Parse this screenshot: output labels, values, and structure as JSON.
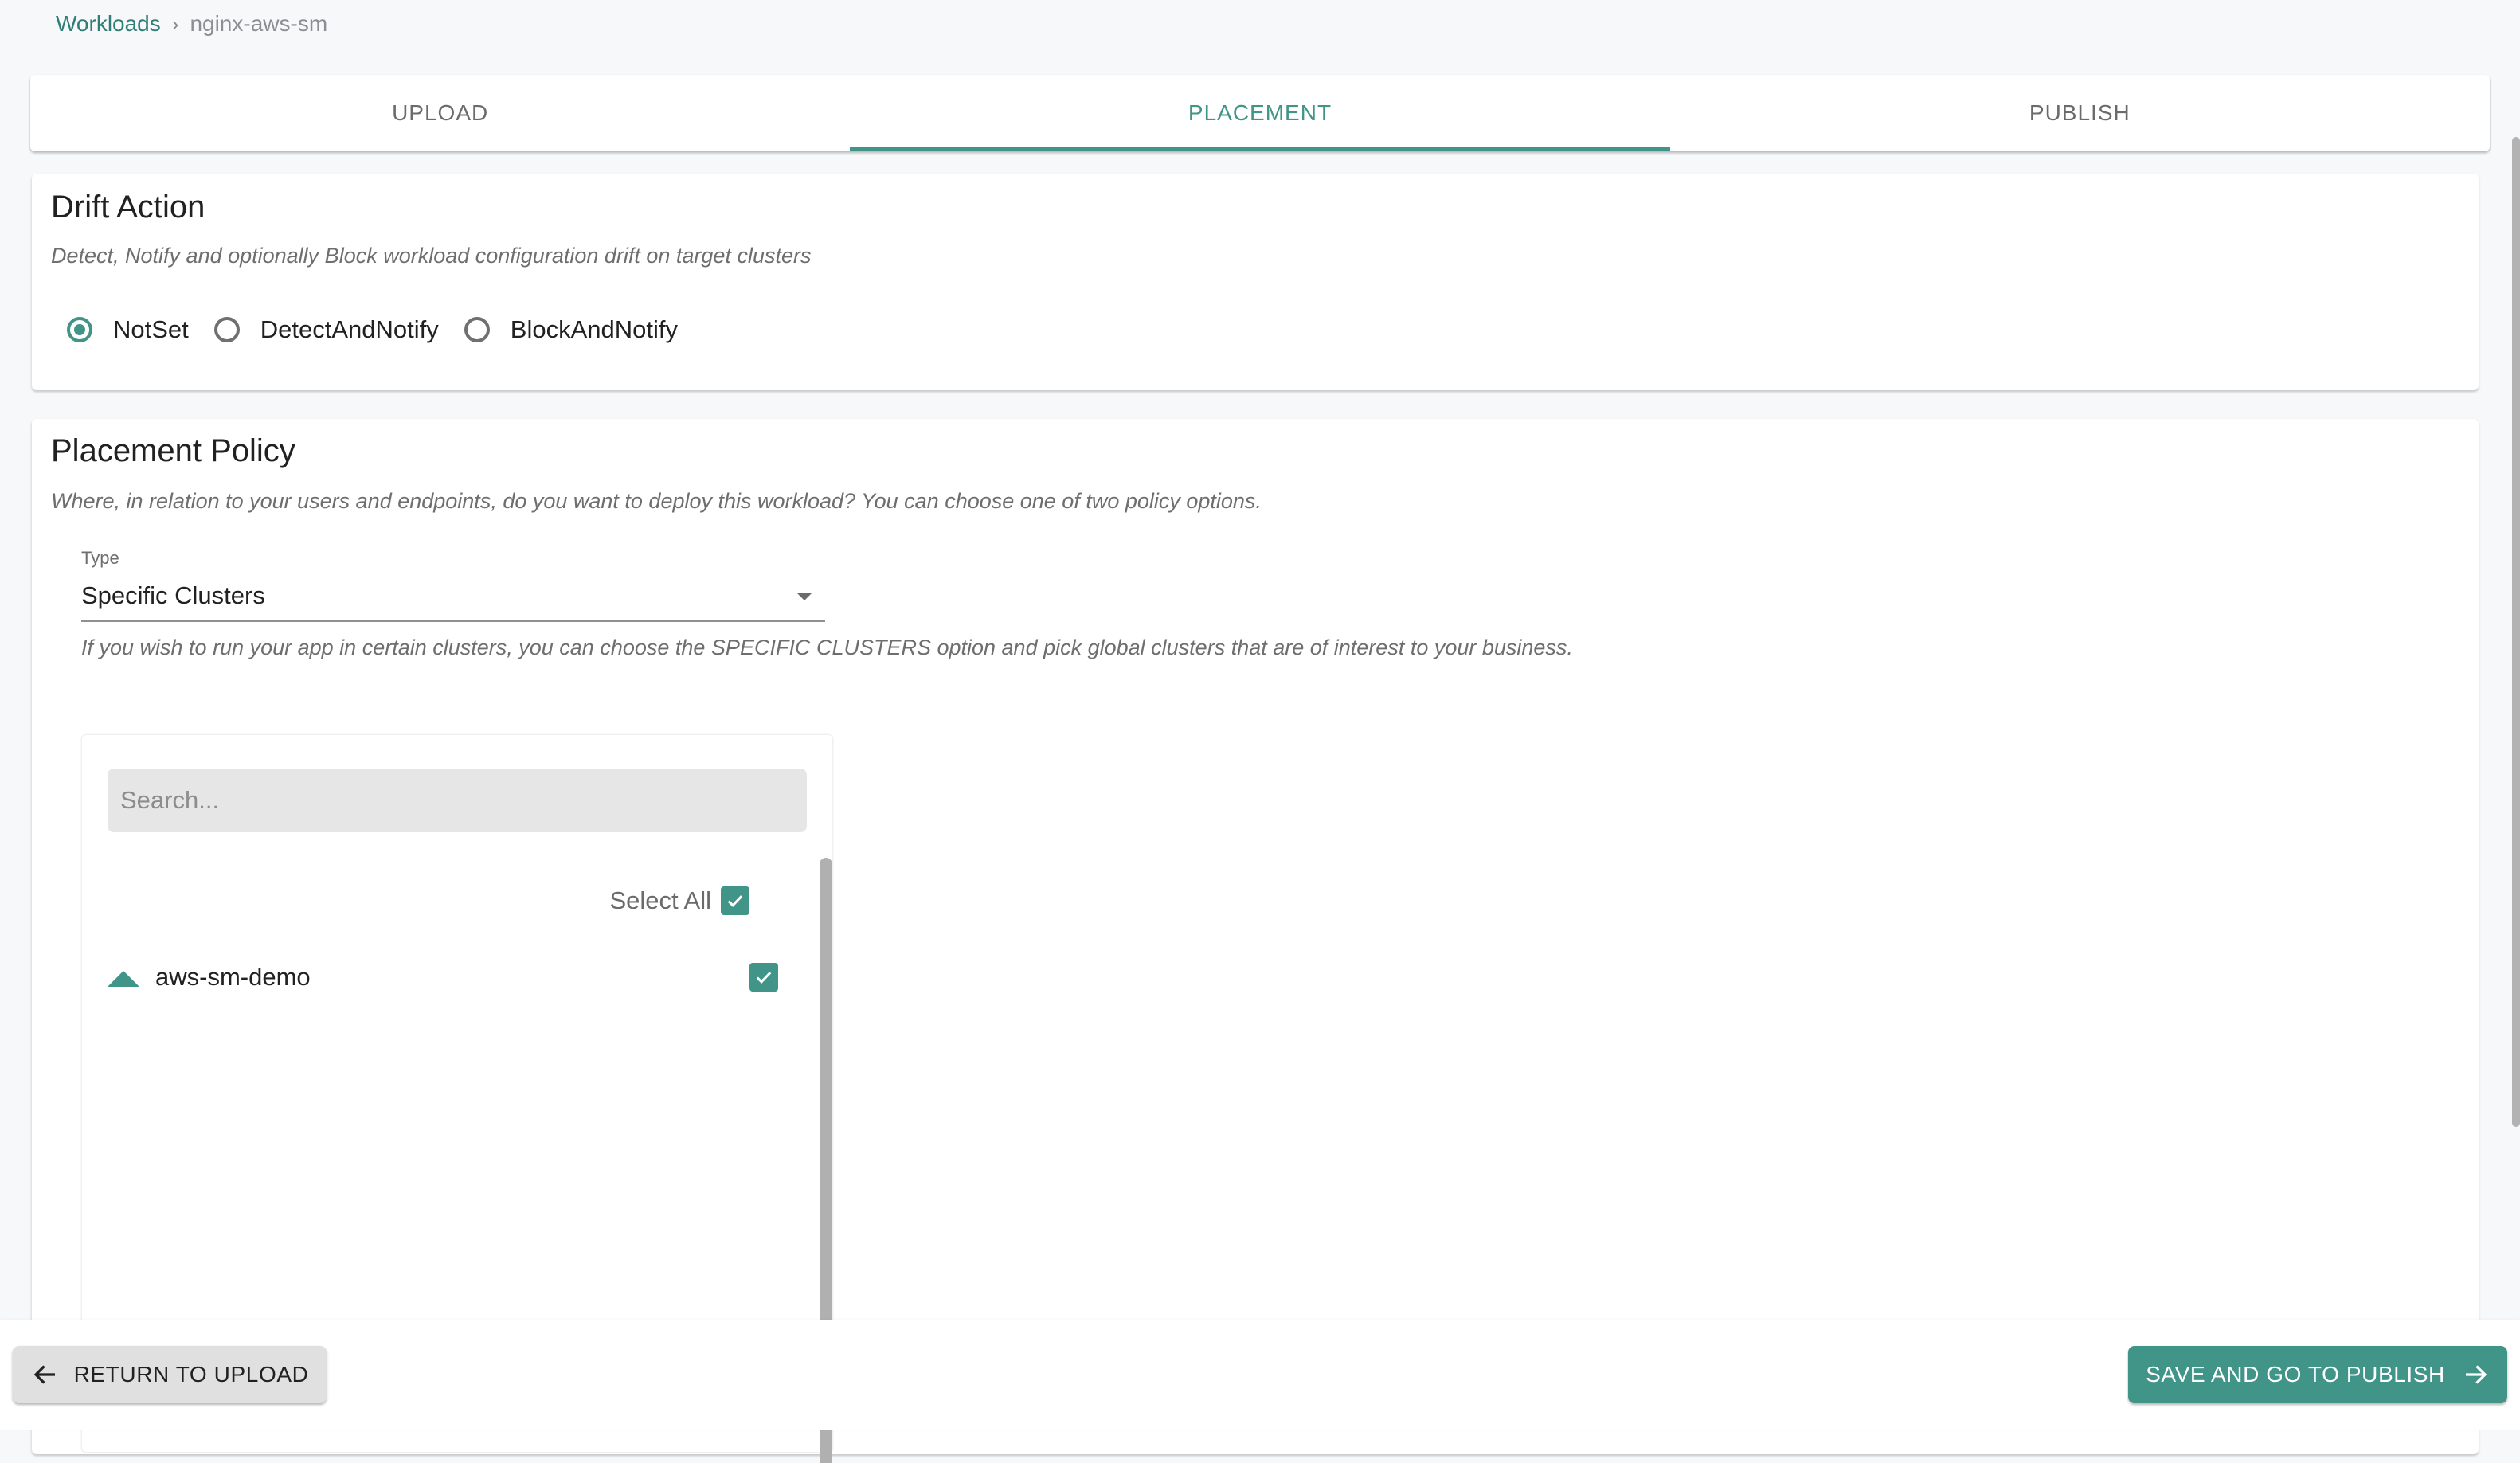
{
  "breadcrumb": {
    "parent": "Workloads",
    "separator_icon": "chevron-right-icon",
    "current": "nginx-aws-sm"
  },
  "tabs": [
    {
      "label": "UPLOAD",
      "active": false
    },
    {
      "label": "PLACEMENT",
      "active": true
    },
    {
      "label": "PUBLISH",
      "active": false
    }
  ],
  "drift_action": {
    "title": "Drift Action",
    "description": "Detect, Notify and optionally Block workload configuration drift on target clusters",
    "options": [
      {
        "label": "NotSet",
        "checked": true
      },
      {
        "label": "DetectAndNotify",
        "checked": false
      },
      {
        "label": "BlockAndNotify",
        "checked": false
      }
    ]
  },
  "placement_policy": {
    "title": "Placement Policy",
    "description": "Where, in relation to your users and endpoints, do you want to deploy this workload? You can choose one of two policy options.",
    "type_label": "Type",
    "type_value": "Specific Clusters",
    "type_hint": "If you wish to run your app in certain clusters, you can choose the SPECIFIC CLUSTERS option and pick global clusters that are of interest to your business.",
    "cluster_list": {
      "search_placeholder": "Search...",
      "search_value": "",
      "select_all_label": "Select All",
      "select_all_checked": true,
      "clusters": [
        {
          "name": "aws-sm-demo",
          "checked": true,
          "icon": "caret-up-icon"
        }
      ]
    }
  },
  "footer": {
    "back_label": "RETURN TO UPLOAD",
    "next_label": "SAVE AND GO TO PUBLISH"
  },
  "colors": {
    "accent": "#419488",
    "link": "#2e7d77",
    "background": "#f7f8fa"
  }
}
